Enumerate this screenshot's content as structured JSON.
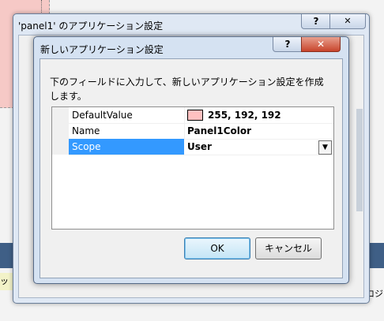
{
  "outer_dialog": {
    "title": "'panel1' のアプリケーション設定",
    "help_label": "?",
    "close_label": "✕"
  },
  "inner_dialog": {
    "title": "新しいアプリケーション設定",
    "help_label": "?",
    "close_label": "✕",
    "description": "下のフィールドに入力して、新しいアプリケーション設定を作成します。",
    "properties": [
      {
        "name": "DefaultValue",
        "value": "255, 192, 192",
        "swatch_color": "#ffc0c0"
      },
      {
        "name": "Name",
        "value": "Panel1Color"
      },
      {
        "name": "Scope",
        "value": "User",
        "selected": true
      }
    ],
    "ok_label": "OK",
    "cancel_label": "キャンセル"
  },
  "background": {
    "left_label": "ッテ",
    "right_label": "ロジ"
  },
  "colors": {
    "selection": "#3399ff",
    "close_red": "#c8452d",
    "panel_pink": "#f6c9c6"
  }
}
